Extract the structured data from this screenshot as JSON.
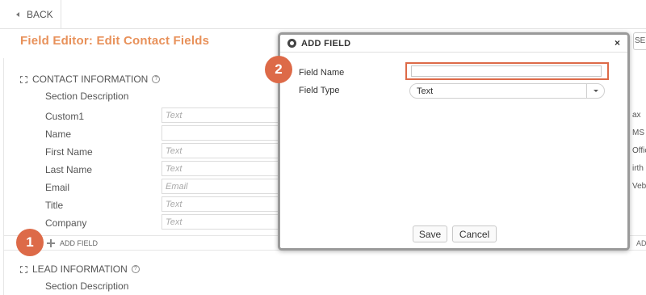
{
  "nav": {
    "back_label": "BACK"
  },
  "page": {
    "title": "Field Editor: Edit Contact Fields",
    "right_button_label": "SES"
  },
  "contact_section": {
    "title": "CONTACT INFORMATION",
    "description_label": "Section Description",
    "fields": [
      {
        "label": "Custom1",
        "placeholder": "Text"
      },
      {
        "label": "Name",
        "placeholder": ""
      },
      {
        "label": "First Name",
        "placeholder": "Text"
      },
      {
        "label": "Last Name",
        "placeholder": "Text"
      },
      {
        "label": "Email",
        "placeholder": "Email"
      },
      {
        "label": "Title",
        "placeholder": "Text"
      },
      {
        "label": "Company",
        "placeholder": "Text"
      }
    ],
    "add_field_label": "ADD FIELD",
    "right_add_label": "AD"
  },
  "right_column_clipped": [
    "ax",
    "MS",
    "Offic",
    "irth",
    "Vebs"
  ],
  "lead_section": {
    "title": "LEAD INFORMATION",
    "description_label": "Section Description"
  },
  "steps": {
    "one": "1",
    "two": "2"
  },
  "modal": {
    "title": "ADD FIELD",
    "close": "×",
    "field_name_label": "Field Name",
    "field_name_value": "",
    "field_type_label": "Field Type",
    "field_type_value": "Text",
    "save_label": "Save",
    "cancel_label": "Cancel"
  },
  "colors": {
    "accent": "#e8915a",
    "step_badge": "#dd6a48"
  },
  "icons": [
    "chevron-left-icon",
    "expand-icon",
    "help-icon",
    "plus-icon",
    "app-logo-icon",
    "close-icon",
    "chevron-down-icon"
  ]
}
